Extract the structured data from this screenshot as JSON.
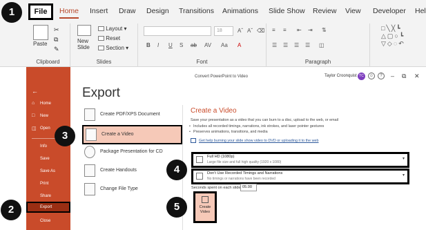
{
  "ribbon": {
    "tabs": [
      "File",
      "Home",
      "Insert",
      "Draw",
      "Design",
      "Transitions",
      "Animations",
      "Slide Show",
      "Review",
      "View",
      "Developer",
      "Help"
    ],
    "active_tab": "Home",
    "groups": {
      "clipboard": {
        "label": "Clipboard",
        "paste": "Paste"
      },
      "slides": {
        "label": "Slides",
        "new_slide": "New\nSlide",
        "layout": "Layout",
        "reset": "Reset",
        "section": "Section"
      },
      "font": {
        "label": "Font",
        "size": "18",
        "buttons": [
          "B",
          "I",
          "U",
          "S",
          "ab",
          "AV",
          "Aa",
          "A"
        ]
      },
      "paragraph": {
        "label": "Paragraph"
      }
    }
  },
  "backstage": {
    "nav": {
      "home": "Home",
      "new": "New",
      "open": "Open",
      "info": "Info",
      "save": "Save",
      "save_as": "Save As",
      "print": "Print",
      "share": "Share",
      "export": "Export",
      "close": "Close"
    },
    "window_title": "Convert PowerPoint to Video",
    "user_name": "Taylor Croonquist",
    "user_initials": "TC",
    "heading": "Export",
    "options": [
      "Create PDF/XPS Document",
      "Create a Video",
      "Package Presentation for CD",
      "Create Handouts",
      "Change File Type"
    ],
    "panel": {
      "title": "Create a Video",
      "description": "Save your presentation as a video that you can burn to a disc, upload to the web, or email",
      "bullets": [
        "Includes all recorded timings, narrations, ink strokes, and laser pointer gestures",
        "Preserves animations, transitions, and media"
      ],
      "help_link": "Get help burning your slide show video to DVD or uploading it to the web",
      "quality": {
        "title": "Full HD (1080p)",
        "subtitle": "Large file size and full high quality (1920 x 1080)"
      },
      "timings": {
        "title": "Don't Use Recorded Timings and Narrations",
        "subtitle": "No timings or narrations have been recorded"
      },
      "seconds_label": "Seconds spent on each slide:",
      "seconds_value": "05.00",
      "create_button": "Create\nVideo"
    }
  },
  "steps": [
    "1",
    "2",
    "3",
    "4",
    "5"
  ],
  "colors": {
    "accent": "#c94b2a",
    "selected": "#f6c9b8",
    "link": "#2b579a"
  }
}
